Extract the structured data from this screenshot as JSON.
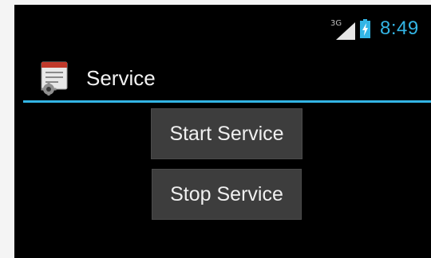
{
  "status_bar": {
    "network": "3G",
    "time": "8:49",
    "icons": [
      "signal-icon",
      "battery-charging-icon"
    ]
  },
  "action_bar": {
    "title": "Service",
    "icon": "app-service-icon"
  },
  "buttons": {
    "start_label": "Start Service",
    "stop_label": "Stop Service"
  },
  "colors": {
    "accent": "#33b5e5",
    "background": "#000000",
    "button": "#3d3d3d"
  }
}
